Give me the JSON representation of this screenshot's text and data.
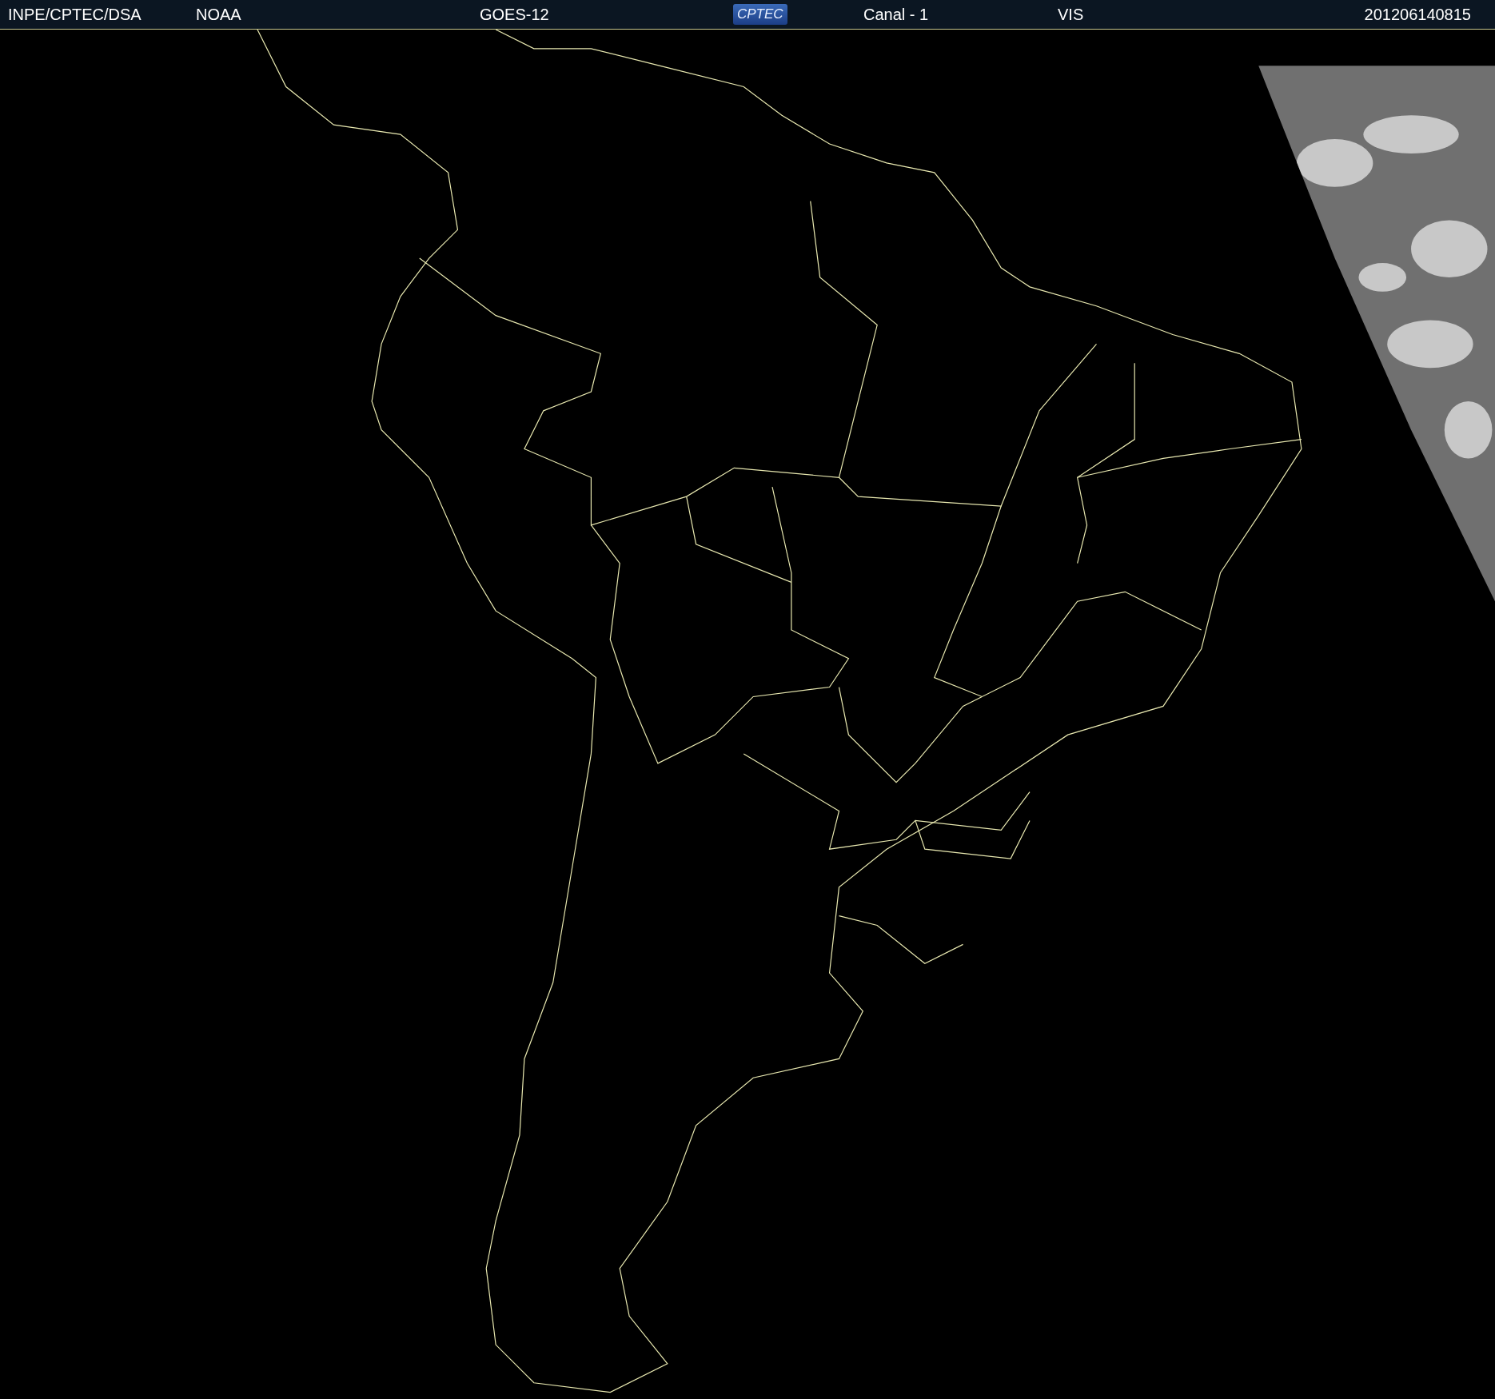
{
  "header": {
    "agency": "INPE/CPTEC/DSA",
    "operator": "NOAA",
    "satellite": "GOES-12",
    "logo": "CPTEC",
    "channel": "Canal - 1",
    "band": "VIS",
    "timestamp": "201206140815"
  }
}
